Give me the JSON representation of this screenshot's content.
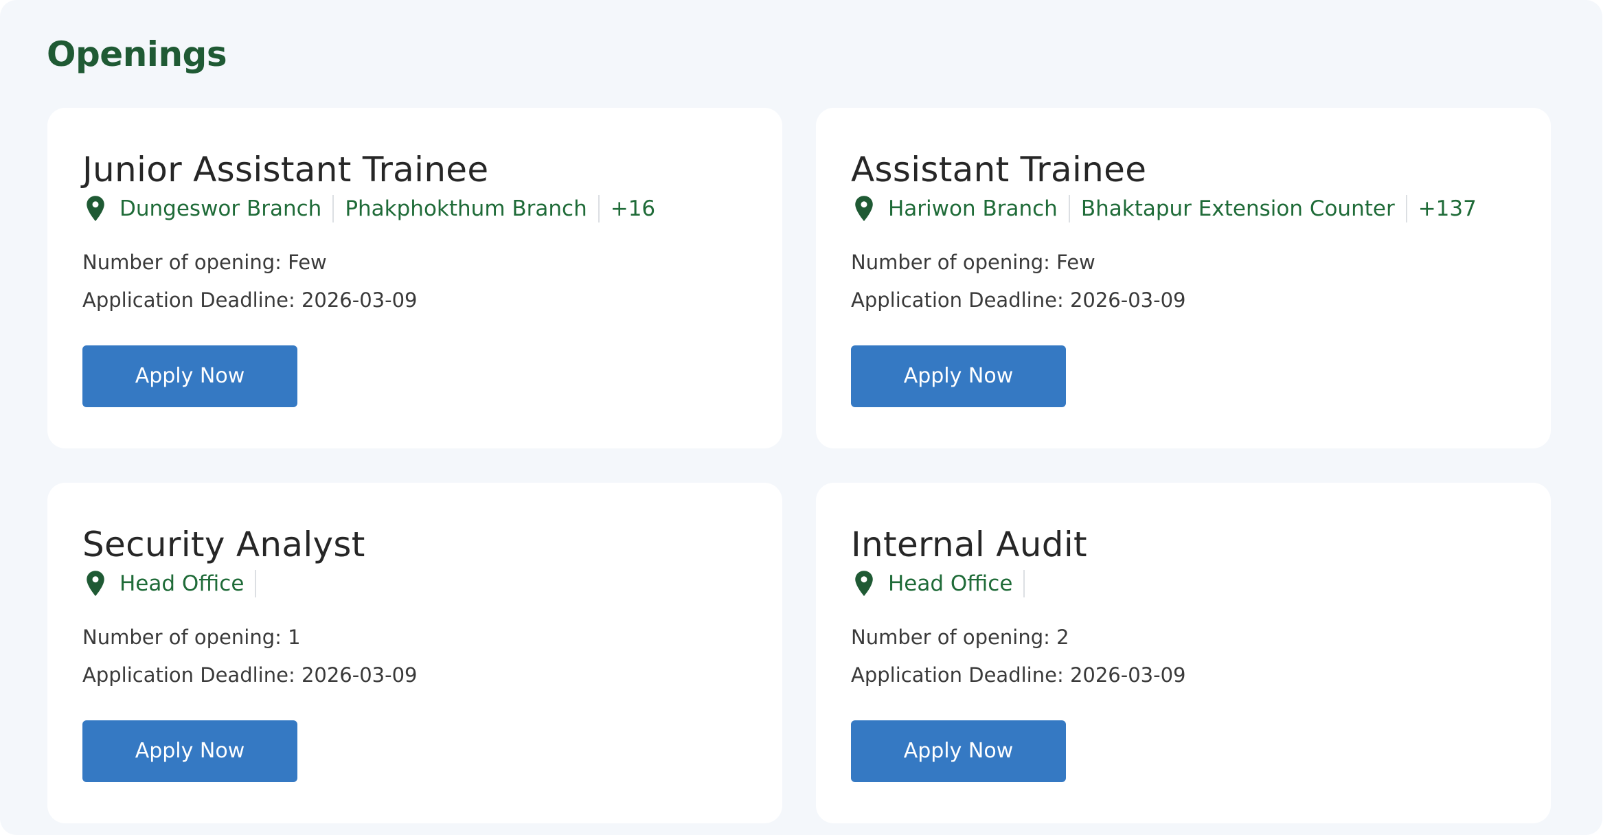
{
  "section": {
    "title": "Openings"
  },
  "jobs": [
    {
      "title": "Junior Assistant Trainee",
      "locations": [
        "Dungeswor Branch",
        "Phakphokthum Branch"
      ],
      "more": "+16",
      "openings_label": "Number of opening:",
      "openings_value": "Few",
      "deadline_label": "Application Deadline:",
      "deadline_value": "2026-03-09",
      "apply_label": "Apply Now"
    },
    {
      "title": "Assistant Trainee",
      "locations": [
        "Hariwon Branch",
        "Bhaktapur Extension Counter"
      ],
      "more": "+137",
      "openings_label": "Number of opening:",
      "openings_value": "Few",
      "deadline_label": "Application Deadline:",
      "deadline_value": "2026-03-09",
      "apply_label": "Apply Now"
    },
    {
      "title": "Security Analyst",
      "locations": [
        "Head Office"
      ],
      "more": "",
      "openings_label": "Number of opening:",
      "openings_value": "1",
      "deadline_label": "Application Deadline:",
      "deadline_value": "2026-03-09",
      "apply_label": "Apply Now"
    },
    {
      "title": "Internal Audit",
      "locations": [
        "Head Office"
      ],
      "more": "",
      "openings_label": "Number of opening:",
      "openings_value": "2",
      "deadline_label": "Application Deadline:",
      "deadline_value": "2026-03-09",
      "apply_label": "Apply Now"
    }
  ],
  "icons": {
    "location": "map-pin-icon"
  },
  "colors": {
    "background": "#f4f7fb",
    "card": "#ffffff",
    "heading_green": "#1f5a34",
    "location_green": "#1f6b38",
    "button_blue": "#3579c3",
    "text_dark": "#262626"
  }
}
